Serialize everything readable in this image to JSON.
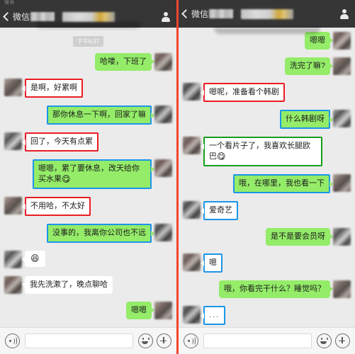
{
  "meta": {
    "divider_color": "#f4452e",
    "bubble_green": "#94ec69",
    "bubble_white": "#ffffff",
    "navbar_color": "#363636",
    "chat_bg": "#ebebeb",
    "highlight_red": "#ec1c24",
    "highlight_blue": "#1b96e8",
    "highlight_green": "#17a01b"
  },
  "left": {
    "statusbar": {
      "text": "搜索"
    },
    "navbar": {
      "back_label": "微信",
      "back_icon": "chevron-left-icon",
      "title": "",
      "right_icon": "contact-person-icon"
    },
    "timestamp": "下午6:37",
    "messages": [
      {
        "side": "right",
        "bubble": "green",
        "highlight": "none",
        "text": "哈喽，下班了"
      },
      {
        "side": "left",
        "bubble": "white",
        "highlight": "red",
        "text": "是啊，好累啊"
      },
      {
        "side": "right",
        "bubble": "green",
        "highlight": "blue",
        "text": "那你休息一下啊，回家了嘛"
      },
      {
        "side": "left",
        "bubble": "white",
        "highlight": "red",
        "text": "回了，今天有点累"
      },
      {
        "side": "right",
        "bubble": "green",
        "highlight": "blue",
        "text": "嗯嗯，累了要休息，改天给你买水果",
        "emoji": "😋"
      },
      {
        "side": "left",
        "bubble": "white",
        "highlight": "red",
        "text": "不用哈，不太好"
      },
      {
        "side": "right",
        "bubble": "green",
        "highlight": "blue",
        "text": "没事的，我离你公司也不远"
      },
      {
        "side": "left",
        "bubble": "white",
        "highlight": "none",
        "text": "",
        "emoji": "😆"
      },
      {
        "side": "left",
        "bubble": "white",
        "highlight": "none",
        "text": "我先洗漱了，晚点聊哈"
      },
      {
        "side": "right",
        "bubble": "green",
        "highlight": "none",
        "text": "嗯嗯"
      }
    ],
    "inputbar": {
      "voice_icon": "voice-record-icon",
      "placeholder": "",
      "emoji_icon": "smiley-face-icon",
      "plus_icon": "plus-more-icon"
    }
  },
  "right": {
    "navbar": {
      "back_label": "微信",
      "back_icon": "chevron-left-icon",
      "title": "",
      "right_icon": "contact-person-icon"
    },
    "messages": [
      {
        "side": "right",
        "bubble": "green",
        "highlight": "none",
        "text": "嗯嗯"
      },
      {
        "side": "right",
        "bubble": "green",
        "highlight": "none",
        "text": "洗完了嘛?"
      },
      {
        "side": "left",
        "bubble": "white",
        "highlight": "red",
        "text": "嗯呢，准备看个韩剧"
      },
      {
        "side": "right",
        "bubble": "green",
        "highlight": "blue",
        "text": "什么韩剧呀"
      },
      {
        "side": "left",
        "bubble": "white",
        "highlight": "green",
        "text": "一个看片子了，我喜欢长腿欧巴",
        "emoji": "😋"
      },
      {
        "side": "right",
        "bubble": "green",
        "highlight": "blue",
        "text": "哦，在哪里，我也看一下"
      },
      {
        "side": "left",
        "bubble": "white",
        "highlight": "blue",
        "text": "爱奇艺"
      },
      {
        "side": "right",
        "bubble": "green",
        "highlight": "none",
        "text": "是不是要会员呀"
      },
      {
        "side": "left",
        "bubble": "white",
        "highlight": "blue",
        "text": "嗯"
      },
      {
        "side": "right",
        "bubble": "green",
        "highlight": "none",
        "text": "哦，你看完干什么？睡觉吗？"
      },
      {
        "side": "left",
        "bubble": "white",
        "highlight": "blue",
        "text": "..."
      }
    ],
    "inputbar": {
      "voice_icon": "voice-record-icon",
      "placeholder": "",
      "emoji_icon": "smiley-face-icon",
      "plus_icon": "plus-more-icon"
    }
  }
}
